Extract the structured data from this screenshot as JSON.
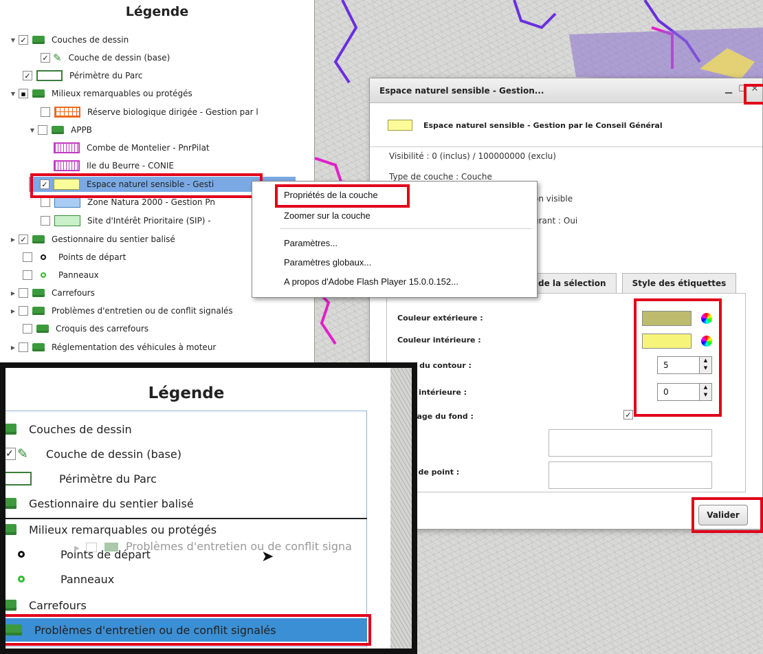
{
  "legend": {
    "title": "Légende",
    "rows": [
      {
        "label": "Couches de dessin"
      },
      {
        "label": "Couche de dessin (base)"
      },
      {
        "label": "Périmètre du Parc"
      },
      {
        "label": "Milieux remarquables ou protégés"
      },
      {
        "label": "Réserve biologique dirigée - Gestion par l"
      },
      {
        "label": "APPB"
      },
      {
        "label": "Combe de Montelier - PnrPilat"
      },
      {
        "label": "Ile du Beurre - CONIE"
      },
      {
        "label": "Espace naturel sensible - Gesti"
      },
      {
        "label": "Zone Natura 2000 - Gestion Pn"
      },
      {
        "label": "Site d'Intérêt Prioritaire (SIP) -"
      },
      {
        "label": "Gestionnaire du sentier balisé"
      },
      {
        "label": "Points de départ"
      },
      {
        "label": "Panneaux"
      },
      {
        "label": "Carrefours"
      },
      {
        "label": "Problèmes d'entretien ou de conflit signalés"
      },
      {
        "label": "Croquis des carrefours"
      },
      {
        "label": "Réglementation des véhicules à moteur"
      }
    ]
  },
  "context_menu": {
    "items": [
      "Propriétés de la couche",
      "Zoomer sur la couche",
      "Paramètres...",
      "Paramètres globaux...",
      "A propos d'Adobe Flash Player 15.0.0.152..."
    ]
  },
  "dialog": {
    "title": "Espace naturel sensible - Gestion...",
    "layer_name": "Espace naturel sensible - Gestion par le Conseil Général",
    "visibility": "Visibilité : 0 (inclus) / 100000000 (exclu)",
    "type": "Type de couche : Couche",
    "line3": "on visible",
    "line4": "urant : Oui",
    "tabs": [
      "de la sélection",
      "Style des étiquettes"
    ],
    "fields": {
      "outer_color_label": "Couleur extérieure :",
      "inner_color_label": "Couleur intérieure :",
      "outline_width_label": "oeur du contour :",
      "outline_width_value": "5",
      "inner_width_label": "seur intérieure :",
      "inner_width_value": "0",
      "fill_label": "plissage du fond :",
      "field6_label": "e :",
      "point_symbol_label": "bole de point :"
    },
    "outer_color": "#bdbb6e",
    "inner_color": "#f6f57a",
    "validate_label": "Valider"
  },
  "inset": {
    "title": "Légende",
    "rows": [
      "Couches de dessin",
      "Couche de dessin (base)",
      "Périmètre du Parc",
      "Gestionnaire du sentier balisé",
      "Milieux remarquables ou protégés",
      "Points de départ",
      "Panneaux",
      "Carrefours",
      "Problèmes d'entretien ou de conflit signalés"
    ],
    "ghost_label": "Problèmes d'entretien ou de conflit signa"
  },
  "colors": {
    "highlight": "#e1001a",
    "selection": "#7aa9e3",
    "inset_selection": "#3b8fd4"
  }
}
